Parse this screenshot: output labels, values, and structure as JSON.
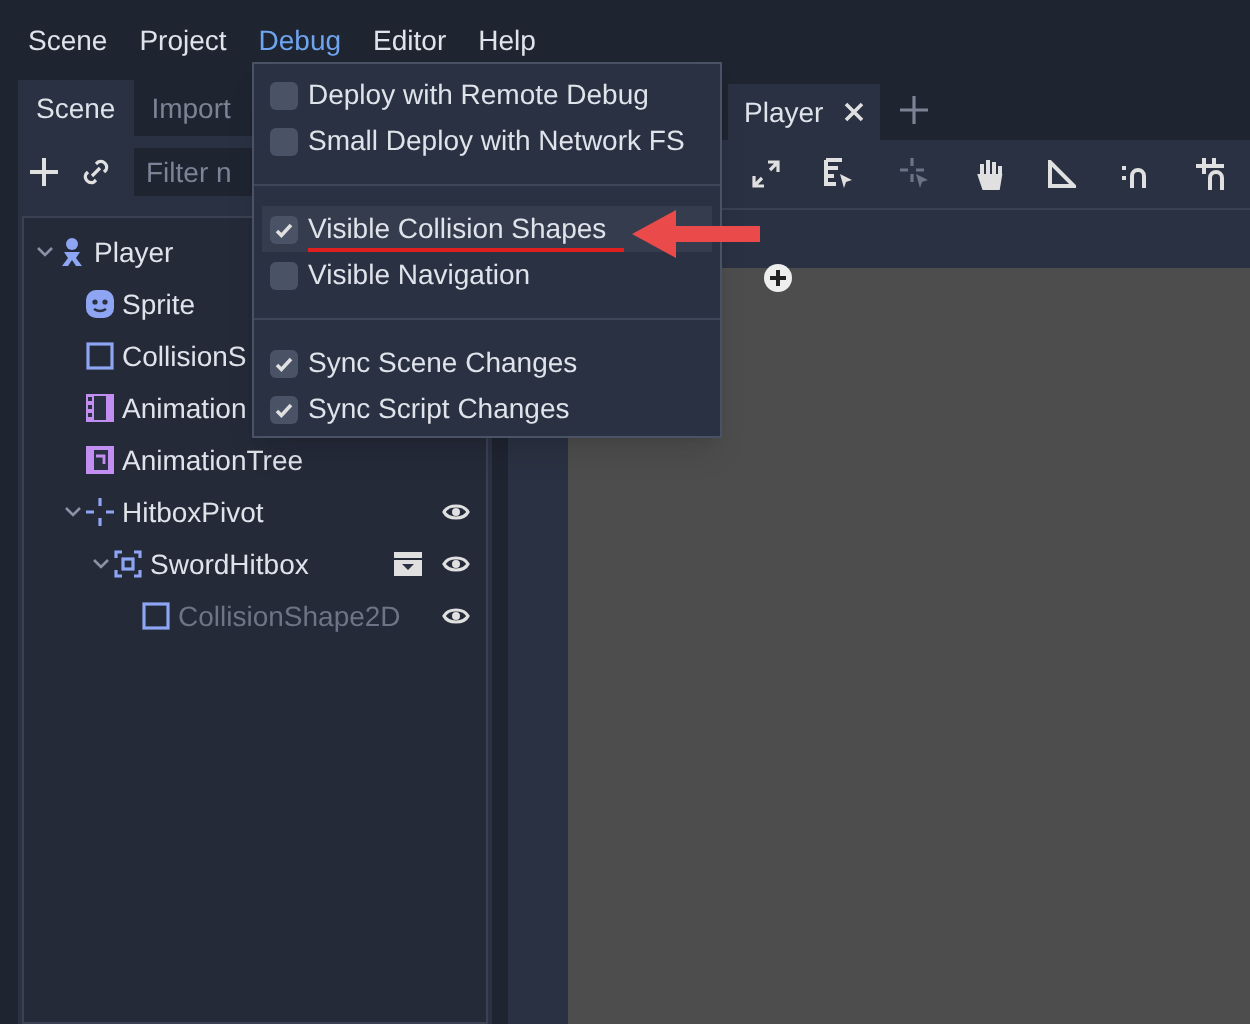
{
  "menu_bar": [
    {
      "label": "Scene",
      "selected": false
    },
    {
      "label": "Project",
      "selected": false
    },
    {
      "label": "Debug",
      "selected": true
    },
    {
      "label": "Editor",
      "selected": false
    },
    {
      "label": "Help",
      "selected": false
    }
  ],
  "dock": {
    "tabs": [
      {
        "label": "Scene",
        "selected": true
      },
      {
        "label": "Import",
        "selected": false
      }
    ],
    "filter_placeholder": "Filter n"
  },
  "tree": [
    {
      "name": "Player",
      "kind": "player",
      "expanded": true,
      "dimmed": false,
      "children": [
        {
          "name": "Sprite",
          "kind": "sprite",
          "dimmed": false
        },
        {
          "name": "CollisionS",
          "kind": "shape",
          "dimmed": false
        },
        {
          "name": "Animation",
          "kind": "film",
          "dimmed": false
        },
        {
          "name": "AnimationTree",
          "kind": "animtree",
          "dimmed": false
        },
        {
          "name": "HitboxPivot",
          "kind": "pivot",
          "expanded": true,
          "visible": true,
          "dimmed": false,
          "children": [
            {
              "name": "SwordHitbox",
              "kind": "area",
              "expanded": true,
              "visible": true,
              "clapper": true,
              "dimmed": false,
              "children": [
                {
                  "name": "CollisionShape2D",
                  "kind": "shape",
                  "visible": true,
                  "dimmed": true
                }
              ]
            }
          ]
        }
      ]
    }
  ],
  "editor_tab": {
    "label": "Player"
  },
  "debug_menu": [
    {
      "label": "Deploy with Remote Debug",
      "checked": false,
      "highlighted": false
    },
    {
      "label": "Small Deploy with Network FS",
      "checked": false,
      "highlighted": false
    },
    {
      "kind": "separator"
    },
    {
      "label": "Visible Collision Shapes",
      "checked": true,
      "highlighted": true
    },
    {
      "label": "Visible Navigation",
      "checked": false,
      "highlighted": false
    },
    {
      "kind": "separator"
    },
    {
      "label": "Sync Scene Changes",
      "checked": true,
      "highlighted": false
    },
    {
      "label": "Sync Script Changes",
      "checked": true,
      "highlighted": false
    }
  ]
}
